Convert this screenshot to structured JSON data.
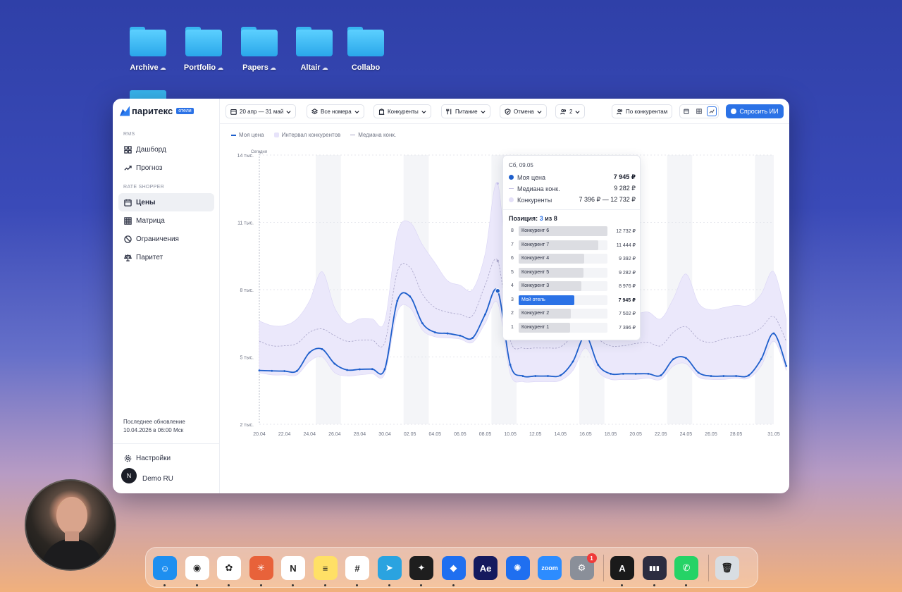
{
  "desktop": {
    "folders": [
      {
        "label": "Archive",
        "cloud": true
      },
      {
        "label": "Portfolio",
        "cloud": true
      },
      {
        "label": "Papers",
        "cloud": true
      },
      {
        "label": "Altair",
        "cloud": true
      },
      {
        "label": "Collabo",
        "cloud": false
      }
    ]
  },
  "app": {
    "logo": "паритекс",
    "logo_badge": "отели",
    "sidebar": {
      "section_rms": "RMS",
      "section_rate": "RATE SHOPPER",
      "items": [
        {
          "label": "Дашборд",
          "icon": "dashboard-icon"
        },
        {
          "label": "Прогноз",
          "icon": "trend-icon"
        },
        {
          "label": "Цены",
          "icon": "calendar-icon",
          "active": true
        },
        {
          "label": "Матрица",
          "icon": "grid-icon"
        },
        {
          "label": "Ограничения",
          "icon": "block-icon"
        },
        {
          "label": "Паритет",
          "icon": "scales-icon"
        }
      ],
      "last_update_label": "Последнее обновление",
      "last_update_value": "10.04.2026 в 06:00 Мск",
      "settings": "Настройки",
      "user_initial": "N",
      "user_name": "Demo RU"
    },
    "toolbar": {
      "date_range": "20 апр — 31 май",
      "rooms": "Все номера",
      "competitors": "Конкуренты",
      "meals": "Питание",
      "cancellation": "Отмена",
      "guests": "2",
      "by_competitors": "По конкурентам",
      "ask_ai": "Спросить ИИ"
    },
    "legend": {
      "my_price": "Моя цена",
      "interval": "Интервал конкурентов",
      "median": "Медиана конк."
    },
    "tooltip": {
      "date": "Сб, 09.05",
      "rows": [
        {
          "label": "Моя цена",
          "value": "7 945 ₽"
        },
        {
          "label": "Медиана конк.",
          "value": "9 282 ₽"
        },
        {
          "label": "Конкуренты",
          "value": "7 396 ₽ — 12 732 ₽"
        }
      ],
      "position_label": "Позиция:",
      "position_value": "3",
      "position_total": "из 8",
      "ranking": [
        {
          "rank": "8",
          "name": "Конкурент 6",
          "price": "12 732 ₽",
          "value": 12732
        },
        {
          "rank": "7",
          "name": "Конкурент 7",
          "price": "11 444 ₽",
          "value": 11444
        },
        {
          "rank": "6",
          "name": "Конкурент 4",
          "price": "9 392 ₽",
          "value": 9392
        },
        {
          "rank": "5",
          "name": "Конкурент 5",
          "price": "9 282 ₽",
          "value": 9282
        },
        {
          "rank": "4",
          "name": "Конкурент 3",
          "price": "8 976 ₽",
          "value": 8976
        },
        {
          "rank": "3",
          "name": "Мой отель",
          "price": "7 945 ₽",
          "value": 7945,
          "me": true
        },
        {
          "rank": "2",
          "name": "Конкурент 2",
          "price": "7 502 ₽",
          "value": 7502
        },
        {
          "rank": "1",
          "name": "Конкурент 1",
          "price": "7 396 ₽",
          "value": 7396
        }
      ]
    }
  },
  "chart_data": {
    "type": "line",
    "today_label": "Сегодня",
    "ylim": [
      2000,
      14000
    ],
    "yticks": [
      {
        "v": 2000,
        "label": "2 тыс."
      },
      {
        "v": 5000,
        "label": "5 тыс."
      },
      {
        "v": 8000,
        "label": "8 тыс."
      },
      {
        "v": 11000,
        "label": "11 тыс."
      },
      {
        "v": 14000,
        "label": "14 тыс."
      }
    ],
    "x_labels": [
      "20.04",
      "22.04",
      "24.04",
      "26.04",
      "28.04",
      "30.04",
      "02.05",
      "04.05",
      "06.05",
      "08.05",
      "10.05",
      "12.05",
      "14.05",
      "16.05",
      "18.05",
      "20.05",
      "22.05",
      "24.05",
      "26.05",
      "28.05",
      "31.05"
    ],
    "days": [
      "20.04",
      "21.04",
      "22.04",
      "23.04",
      "24.04",
      "25.04",
      "26.04",
      "27.04",
      "28.04",
      "29.04",
      "30.04",
      "01.05",
      "02.05",
      "03.05",
      "04.05",
      "05.05",
      "06.05",
      "07.05",
      "08.05",
      "09.05",
      "10.05",
      "11.05",
      "12.05",
      "13.05",
      "14.05",
      "15.05",
      "16.05",
      "17.05",
      "18.05",
      "19.05",
      "20.05",
      "21.05",
      "22.05",
      "23.05",
      "24.05",
      "25.05",
      "26.05",
      "27.05",
      "28.05",
      "29.05",
      "30.05",
      "31.05"
    ],
    "weekend_bands": [
      [
        "25.04",
        "26.04"
      ],
      [
        "02.05",
        "03.05"
      ],
      [
        "09.05",
        "10.05"
      ],
      [
        "16.05",
        "17.05"
      ],
      [
        "23.05",
        "24.05"
      ],
      [
        "30.05",
        "31.05"
      ]
    ],
    "series": [
      {
        "name": "Моя цена",
        "values": [
          4400,
          4380,
          4370,
          4380,
          5200,
          5350,
          4700,
          4420,
          4450,
          4460,
          4460,
          7500,
          7700,
          6500,
          6100,
          6050,
          5950,
          5850,
          6900,
          7945,
          4650,
          4150,
          4150,
          4150,
          4180,
          4800,
          5950,
          4650,
          4250,
          4250,
          4250,
          4250,
          4180,
          4900,
          4950,
          4300,
          4150,
          4150,
          4150,
          4180,
          4900,
          6050,
          4600
        ]
      },
      {
        "name": "Медиана конк.",
        "values": [
          5700,
          5500,
          5500,
          5600,
          6100,
          6250,
          5950,
          5700,
          5750,
          5750,
          5650,
          8800,
          9000,
          7800,
          7200,
          7000,
          6900,
          6850,
          8200,
          9282,
          5750,
          5400,
          5400,
          5400,
          5450,
          6000,
          7000,
          5850,
          5500,
          5500,
          5600,
          5650,
          5500,
          6100,
          6350,
          5800,
          5650,
          5800,
          5900,
          6000,
          6300,
          6800,
          5700
        ]
      },
      {
        "name": "Интервал конкурентов min",
        "values": [
          4300,
          4200,
          4200,
          4200,
          4800,
          5000,
          4300,
          4150,
          4200,
          4250,
          4250,
          7000,
          7200,
          6200,
          5900,
          5850,
          5800,
          5650,
          6500,
          7396,
          4250,
          3900,
          3900,
          3900,
          3950,
          4400,
          5400,
          4350,
          4000,
          4000,
          4000,
          4050,
          4000,
          4600,
          4700,
          4100,
          4000,
          4000,
          4050,
          4050,
          4600,
          5700,
          4400
        ]
      },
      {
        "name": "Интервал конкурентов max",
        "values": [
          6600,
          6400,
          6400,
          6700,
          7500,
          8800,
          7200,
          6500,
          6700,
          6700,
          6600,
          10500,
          11000,
          10000,
          9200,
          8400,
          8200,
          8000,
          9600,
          12732,
          6900,
          6600,
          6600,
          6600,
          6700,
          7200,
          8600,
          7000,
          6600,
          6700,
          6900,
          7000,
          6700,
          7600,
          8700,
          7400,
          7100,
          7200,
          7300,
          7300,
          7800,
          8800,
          6700
        ]
      }
    ],
    "tooltip_index": 19
  },
  "dock": {
    "items": [
      {
        "name": "finder-icon",
        "text": "☺",
        "color": "#1e8ff0",
        "dot": true
      },
      {
        "name": "chrome-icon",
        "text": "◉",
        "color": "#ffffff",
        "dot": true
      },
      {
        "name": "chatgpt-icon",
        "text": "✿",
        "color": "#ffffff",
        "dot": true
      },
      {
        "name": "claude-icon",
        "text": "✳",
        "color": "#e8623a",
        "dot": true
      },
      {
        "name": "notion-icon",
        "text": "N",
        "color": "#ffffff",
        "dot": true
      },
      {
        "name": "notes-icon",
        "text": "≡",
        "color": "#ffe066",
        "dot": true
      },
      {
        "name": "slack-icon",
        "text": "#",
        "color": "#ffffff",
        "dot": true
      },
      {
        "name": "telegram-icon",
        "text": "➤",
        "color": "#2aa3e0",
        "dot": true
      },
      {
        "name": "figma-icon",
        "text": "✦",
        "color": "#1e1e1e",
        "dot": true
      },
      {
        "name": "framer-icon",
        "text": "◆",
        "color": "#1f6ff0",
        "dot": true
      },
      {
        "name": "after-effects-icon",
        "text": "Ae",
        "color": "#151a5e",
        "dot": false
      },
      {
        "name": "perplexity-icon",
        "text": "✺",
        "color": "#1f6ff0",
        "dot": false
      },
      {
        "name": "zoom-icon",
        "text": "zoom",
        "color": "#2d8cff",
        "dot": false
      },
      {
        "name": "system-settings-icon",
        "text": "⚙",
        "color": "#8a8f99",
        "dot": false,
        "badge": "1"
      },
      {
        "name": "vpn-icon",
        "text": "A",
        "color": "#1a1a1a",
        "dot": true
      },
      {
        "name": "audio-app-icon",
        "text": "▮▮▮",
        "color": "#2c2d40",
        "dot": true
      },
      {
        "name": "whatsapp-icon",
        "text": "✆",
        "color": "#25d366",
        "dot": true
      },
      {
        "name": "trash-icon",
        "text": "🗑",
        "color": "#d8dde2",
        "dot": false
      }
    ]
  }
}
